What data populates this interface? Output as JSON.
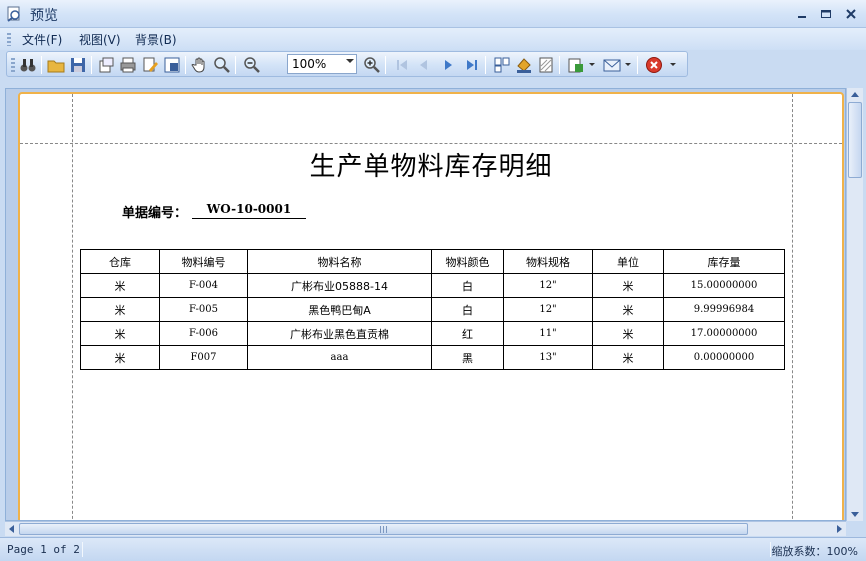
{
  "window": {
    "title": "预览"
  },
  "menu": {
    "items": [
      "文件(F)",
      "视图(V)",
      "背景(B)"
    ]
  },
  "toolbar": {
    "zoom_value": "100%",
    "icons": [
      "binoculars-icon",
      "open-folder-icon",
      "save-icon",
      "page-setup-icon",
      "print-icon",
      "print-options-icon",
      "scale-icon",
      "hand-tool-icon",
      "magnifier-icon",
      "zoom-out-icon",
      "zoom-in-icon",
      "first-page-icon",
      "previous-page-icon",
      "next-page-icon",
      "last-page-icon",
      "multiple-pages-icon",
      "page-color-icon",
      "watermark-icon",
      "export-icon",
      "email-icon",
      "close-preview-icon"
    ]
  },
  "report": {
    "title": "生产单物料库存明细",
    "doc_label": "单据编号：",
    "doc_value": "WO-10-0001",
    "columns": [
      "仓库",
      "物料编号",
      "物料名称",
      "物料颜色",
      "物料规格",
      "单位",
      "库存量"
    ],
    "rows": [
      [
        "米",
        "F-004",
        "广彬布业05888-14",
        "白",
        "12\"",
        "米",
        "15.00000000"
      ],
      [
        "米",
        "F-005",
        "黑色鸭巴甸A",
        "白",
        "12\"",
        "米",
        "9.99996984"
      ],
      [
        "米",
        "F-006",
        "广彬布业黑色直贡棉",
        "红",
        "11\"",
        "米",
        "17.00000000"
      ],
      [
        "米",
        "F007",
        "aaa",
        "黑",
        "13\"",
        "米",
        "0.00000000"
      ]
    ]
  },
  "status": {
    "page": "Page 1 of 2",
    "zoom": "缩放系数：100%"
  },
  "colors": {
    "page_border": "#f0b24a",
    "chrome": "#c9dbf2"
  }
}
